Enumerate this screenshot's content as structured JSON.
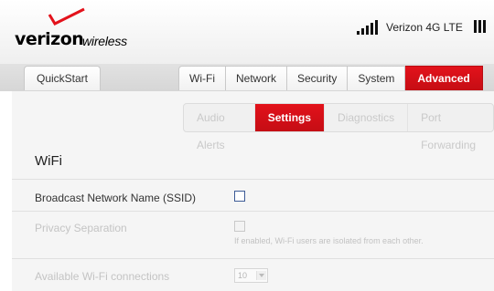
{
  "brand": {
    "name": "verizon",
    "sub": "wireless"
  },
  "status": {
    "carrier": "Verizon 4G LTE",
    "signal_bars": 5
  },
  "nav": {
    "quickstart": "QuickStart",
    "tabs": [
      "Wi-Fi",
      "Network",
      "Security",
      "System",
      "Advanced"
    ],
    "active_tab": "Advanced"
  },
  "subnav": {
    "tabs": [
      "Audio Alerts",
      "Settings",
      "Diagnostics",
      "Port Forwarding"
    ],
    "active": "Settings"
  },
  "section": {
    "title": "WiFi"
  },
  "form": {
    "broadcast_label": "Broadcast Network Name (SSID)",
    "broadcast_checked": false,
    "privacy_label": "Privacy Separation",
    "privacy_hint": "If enabled, Wi-Fi users are isolated from each other.",
    "connections_label": "Available Wi-Fi connections",
    "connections_value": "10"
  },
  "colors": {
    "accent": "#e3121b",
    "tab_bg": "#f1f1f1",
    "checkbox_border": "#3d5b96"
  }
}
